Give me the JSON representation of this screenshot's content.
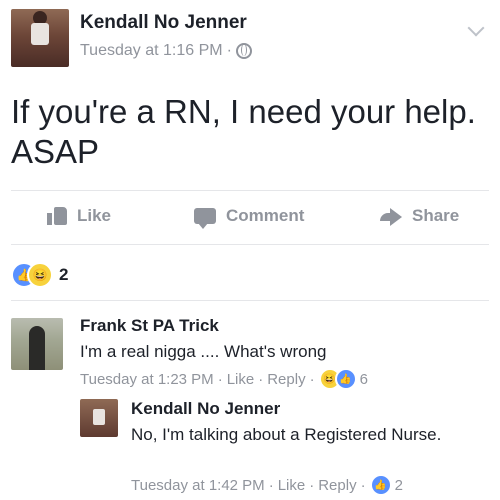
{
  "post": {
    "author": "Kendall No Jenner",
    "time": "Tuesday at 1:16 PM",
    "separator": "·",
    "text": "If you're a RN, I need your help. ASAP"
  },
  "actions": {
    "like": "Like",
    "comment": "Comment",
    "share": "Share"
  },
  "reactions": {
    "count": "2",
    "types": [
      "like-icon",
      "haha-icon"
    ]
  },
  "comments": [
    {
      "author": "Frank St PA Trick",
      "text": "I'm a real nigga .... What's wrong",
      "time": "Tuesday at 1:23 PM",
      "like": "Like",
      "reply": "Reply",
      "reaction_count": "6",
      "reaction_types": [
        "haha-icon",
        "like-icon"
      ]
    },
    {
      "author": "Kendall No Jenner",
      "text": "No, I'm talking about a Registered Nurse.",
      "time": "Tuesday at 1:42 PM",
      "like": "Like",
      "reply": "Reply",
      "reaction_count": "2",
      "reaction_types": [
        "like-icon"
      ]
    }
  ],
  "colors": {
    "text": "#1d2129",
    "meta": "#90949c",
    "like_blue": "#5890ff",
    "haha_yellow": "#f7d23c"
  }
}
